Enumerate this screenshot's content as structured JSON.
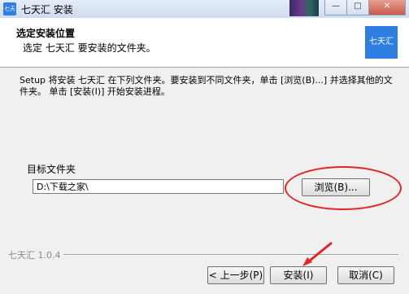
{
  "window": {
    "title": "七天汇 安装",
    "icon_text": "七天",
    "controls": [
      "minimize",
      "maximize",
      "close"
    ]
  },
  "header": {
    "title": "选定安装位置",
    "subtitle": "选定 七天汇 要安装的文件夹。",
    "logo_text": "七天汇"
  },
  "description": "Setup 将安装 七天汇 在下列文件夹。要安装到不同文件夹，单击 [浏览(B)...] 并选择其他的文件夹。 单击 [安装(I)] 开始安装进程。",
  "destination": {
    "label": "目标文件夹",
    "path": "D:\\下载之家\\",
    "browse_label": "浏览(B)..."
  },
  "footer": {
    "version": "七天汇 1.0.4",
    "back_label": "< 上一步(P)",
    "install_label": "安装(I)",
    "cancel_label": "取消(C)"
  },
  "annotations": {
    "highlight_color": "#e52525"
  }
}
